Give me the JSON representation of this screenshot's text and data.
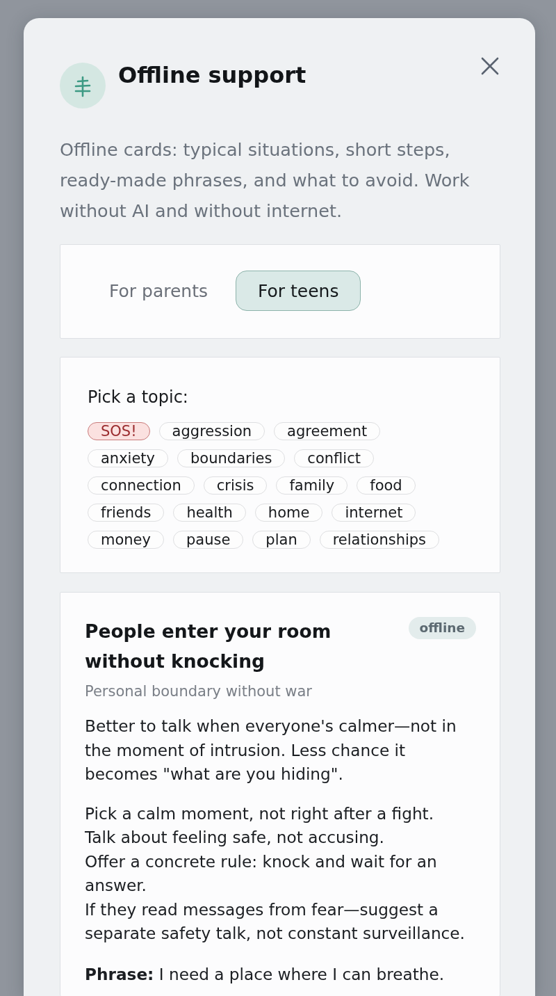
{
  "dialog": {
    "title": "Offline support",
    "description": "Offline cards: typical situations, short steps, ready-made phrases, and what to avoid. Work without AI and without internet."
  },
  "audience_tabs": [
    {
      "label": "For parents",
      "selected": false
    },
    {
      "label": "For teens",
      "selected": true
    }
  ],
  "topics": {
    "heading": "Pick a topic:",
    "items": [
      {
        "label": "SOS!",
        "kind": "sos",
        "selected": false
      },
      {
        "label": "aggression",
        "kind": "topic",
        "selected": false
      },
      {
        "label": "agreement",
        "kind": "topic",
        "selected": false
      },
      {
        "label": "anxiety",
        "kind": "topic",
        "selected": false
      },
      {
        "label": "boundaries",
        "kind": "topic",
        "selected": false
      },
      {
        "label": "conflict",
        "kind": "topic",
        "selected": false
      },
      {
        "label": "connection",
        "kind": "topic",
        "selected": false
      },
      {
        "label": "crisis",
        "kind": "topic",
        "selected": false
      },
      {
        "label": "family",
        "kind": "topic",
        "selected": false
      },
      {
        "label": "food",
        "kind": "topic",
        "selected": false
      },
      {
        "label": "friends",
        "kind": "topic",
        "selected": false
      },
      {
        "label": "health",
        "kind": "topic",
        "selected": false
      },
      {
        "label": "home",
        "kind": "topic",
        "selected": false
      },
      {
        "label": "internet",
        "kind": "topic",
        "selected": false
      },
      {
        "label": "money",
        "kind": "topic",
        "selected": false
      },
      {
        "label": "pause",
        "kind": "topic",
        "selected": false
      },
      {
        "label": "plan",
        "kind": "topic",
        "selected": false
      },
      {
        "label": "relationships",
        "kind": "topic",
        "selected": false
      }
    ]
  },
  "card": {
    "title": "People enter your room without knocking",
    "badge": "offline",
    "subtitle": "Personal boundary without war",
    "intro": "Better to talk when everyone's calmer—not in the moment of intrusion. Less chance it becomes \"what are you hiding\".",
    "steps": [
      "Pick a calm moment, not right after a fight.",
      "Talk about feeling safe, not accusing.",
      "Offer a concrete rule: knock and wait for an answer.",
      "If they read messages from fear—suggest a separate safety talk, not constant surveillance."
    ],
    "phrase": "**Phrase:** I need a place where I can breathe."
  }
}
